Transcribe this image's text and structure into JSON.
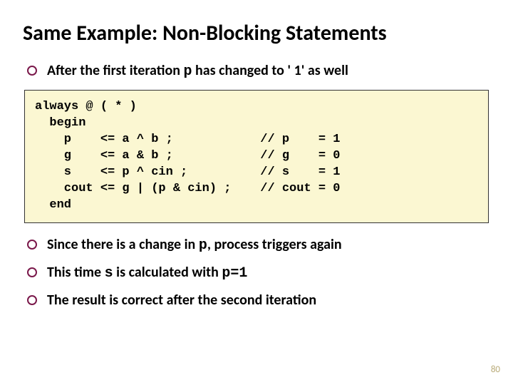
{
  "title": "Same Example: Non-Blocking Statements",
  "bullets": {
    "b1_pre": "After the first iteration ",
    "b1_var": "p",
    "b1_post": " has changed to ' 1' as well",
    "b2_pre": "Since there is a change in ",
    "b2_var": "p",
    "b2_post": ", process triggers again",
    "b3_pre": "This time ",
    "b3_var1": "s",
    "b3_mid": " is calculated with ",
    "b3_var2": "p=1",
    "b4": "The result is correct after the second iteration"
  },
  "code": "always @ ( * )\n  begin\n    p    <= a ^ b ;            // p    = 1\n    g    <= a & b ;            // g    = 0\n    s    <= p ^ cin ;          // s    = 1\n    cout <= g | (p & cin) ;    // cout = 0\n  end",
  "page_number": "80"
}
